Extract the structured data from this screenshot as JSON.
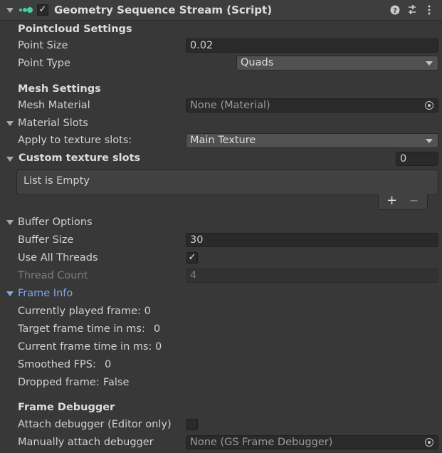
{
  "component": {
    "title": "Geometry Sequence Stream (Script)",
    "enabled": true,
    "icons": [
      "component-script-icon",
      "help-icon",
      "presets-icon",
      "kebab-menu-icon"
    ]
  },
  "pointcloud": {
    "heading": "Pointcloud Settings",
    "point_size_label": "Point Size",
    "point_size_value": "0.02",
    "point_type_label": "Point Type",
    "point_type_value": "Quads"
  },
  "mesh": {
    "heading": "Mesh Settings",
    "material_label": "Mesh Material",
    "material_value": "None (Material)"
  },
  "material_slots": {
    "heading": "Material Slots",
    "apply_label": "Apply to texture slots:",
    "apply_value": "Main Texture"
  },
  "custom_slots": {
    "heading": "Custom texture slots",
    "count": "0",
    "empty_text": "List is Empty",
    "add": "+",
    "remove": "−"
  },
  "buffer": {
    "heading": "Buffer Options",
    "size_label": "Buffer Size",
    "size_value": "30",
    "threads_label": "Use All Threads",
    "threads_checked": true,
    "thread_count_label": "Thread Count",
    "thread_count_value": "4"
  },
  "frame_info": {
    "heading": "Frame Info",
    "played_frame": "Currently played frame: 0",
    "target_time_label": "Target frame time in ms:",
    "target_time_value": "0",
    "current_time_label": "Current frame time in ms:",
    "current_time_value": "0",
    "fps_label": "Smoothed FPS:",
    "fps_value": "0",
    "dropped_label": "Dropped frame:",
    "dropped_value": "False"
  },
  "debugger": {
    "heading": "Frame Debugger",
    "attach_label": "Attach debugger (Editor only)",
    "attach_checked": false,
    "manual_label": "Manually attach debugger",
    "manual_value": "None (GS Frame Debugger)"
  },
  "check_glyph": "✓"
}
